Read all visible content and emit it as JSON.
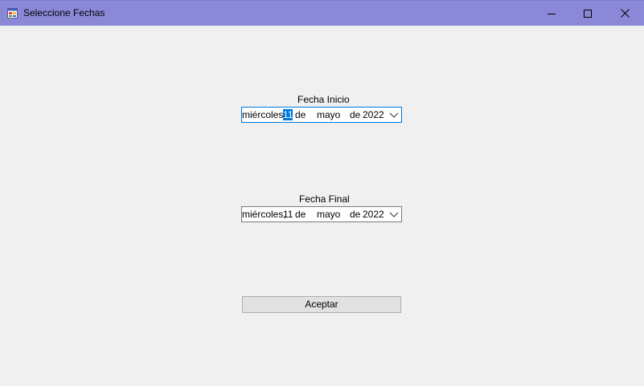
{
  "window": {
    "title": "Seleccione Fechas"
  },
  "fecha_inicio": {
    "label": "Fecha Inicio",
    "weekday": "miércoles,",
    "day": "11",
    "de1": "de",
    "month": "mayo",
    "de2": "de",
    "year": "2022"
  },
  "fecha_final": {
    "label": "Fecha Final",
    "weekday": "miércoles,",
    "day": "11",
    "de1": "de",
    "month": "mayo",
    "de2": "de",
    "year": "2022"
  },
  "accept_button": {
    "label": "Aceptar"
  },
  "colors": {
    "titlebar": "#8b88d8",
    "background": "#f0f0f0",
    "focus_accent": "#0078d7"
  },
  "icons": {
    "app": "app-form-icon",
    "minimize": "minimize-icon",
    "maximize": "maximize-icon",
    "close": "close-icon",
    "dropdown": "chevron-down-icon"
  }
}
